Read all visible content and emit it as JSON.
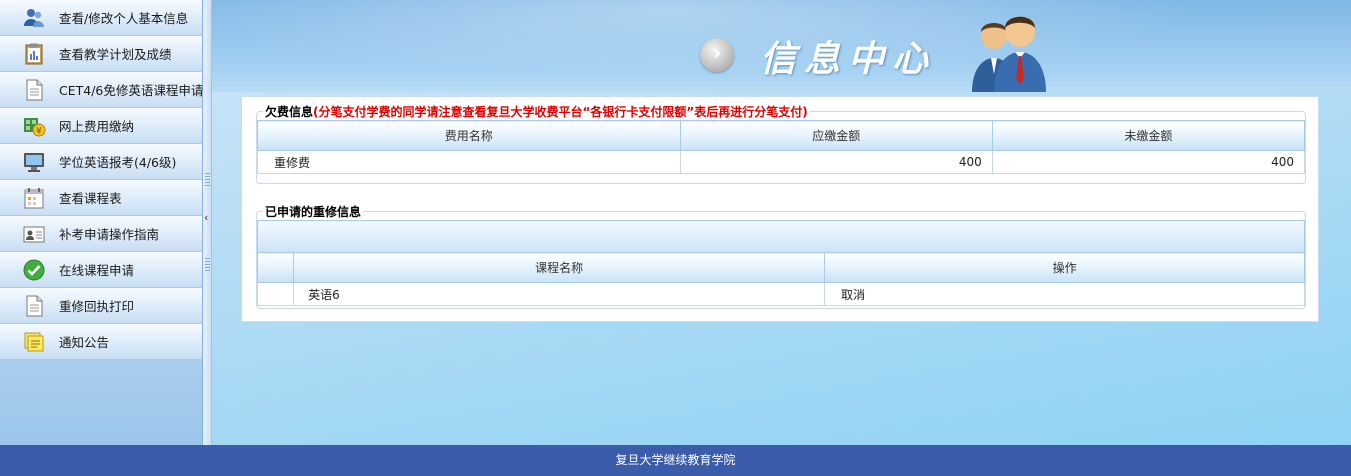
{
  "sidebar": {
    "items": [
      {
        "label": "查看/修改个人基本信息",
        "icon": "user-group-icon"
      },
      {
        "label": "查看教学计划及成绩",
        "icon": "clipboard-icon"
      },
      {
        "label": "CET4/6免修英语课程申请",
        "icon": "document-icon"
      },
      {
        "label": "网上费用缴纳",
        "icon": "payment-icon"
      },
      {
        "label": "学位英语报考(4/6级)",
        "icon": "monitor-icon"
      },
      {
        "label": "查看课程表",
        "icon": "calendar-icon"
      },
      {
        "label": "补考申请操作指南",
        "icon": "id-card-icon"
      },
      {
        "label": "在线课程申请",
        "icon": "check-circle-icon"
      },
      {
        "label": "重修回执打印",
        "icon": "document-icon"
      },
      {
        "label": "通知公告",
        "icon": "notes-icon"
      }
    ]
  },
  "splitter": {
    "toggle_glyph": "‹"
  },
  "banner": {
    "title": "信息中心",
    "arrow_glyph": "›"
  },
  "arrears": {
    "legend_title": "欠费信息",
    "legend_notice": "(分笔支付学费的同学请注意查看复旦大学收费平台“各银行卡支付限额”表后再进行分笔支付)",
    "columns": [
      "费用名称",
      "应缴金额",
      "未缴金额"
    ],
    "rows": [
      {
        "name": "重修费",
        "due": "400",
        "unpaid": "400"
      }
    ]
  },
  "retakes": {
    "legend_title": "已申请的重修信息",
    "columns": [
      "课程名称",
      "操作"
    ],
    "rows": [
      {
        "course": "英语6",
        "action": "取消"
      }
    ]
  },
  "footer": {
    "text": "复旦大学继续教育学院"
  },
  "colors": {
    "footer_bg": "#3a5caa",
    "notice_red": "#e00000",
    "header_blue": "#a9cbe6"
  }
}
